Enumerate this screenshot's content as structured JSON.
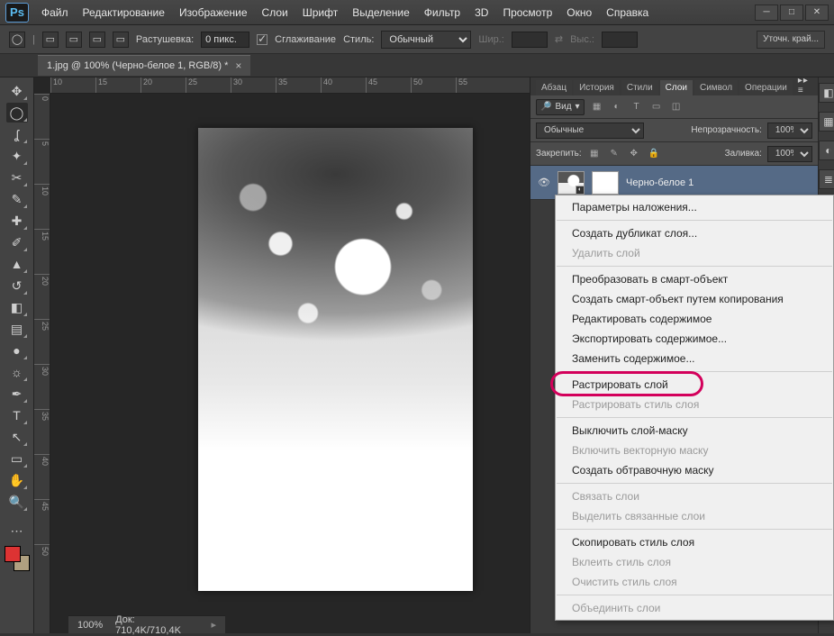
{
  "app_logo": "Ps",
  "menu": [
    "Файл",
    "Редактирование",
    "Изображение",
    "Слои",
    "Шрифт",
    "Выделение",
    "Фильтр",
    "3D",
    "Просмотр",
    "Окно",
    "Справка"
  ],
  "window_controls": {
    "min": "─",
    "max": "□",
    "close": "✕"
  },
  "options_bar": {
    "feather_label": "Растушевка:",
    "feather_value": "0 пикс.",
    "antialias_label": "Сглаживание",
    "style_label": "Стиль:",
    "style_value": "Обычный",
    "width_label": "Шир.:",
    "height_label": "Выс.:",
    "refine_label": "Уточн. край..."
  },
  "document_tab": {
    "title": "1.jpg @ 100% (Черно-белое 1, RGB/8) *"
  },
  "ruler_h": [
    "10",
    "15",
    "20",
    "25",
    "30",
    "35",
    "40",
    "45",
    "50",
    "55"
  ],
  "ruler_v": [
    "0",
    "5",
    "10",
    "15",
    "20",
    "25",
    "30",
    "35",
    "40",
    "45",
    "50"
  ],
  "panel_tabs": [
    "Абзац",
    "История",
    "Стили",
    "Слои",
    "Символ",
    "Операции"
  ],
  "panel_tabs_active_index": 3,
  "layers_panel": {
    "search_label": "Вид",
    "blend_mode": "Обычные",
    "opacity_label": "Непрозрачность:",
    "opacity_value": "100%",
    "lock_label": "Закрепить:",
    "fill_label": "Заливка:",
    "fill_value": "100%",
    "layer_name": "Черно-белое 1"
  },
  "context_menu": {
    "items": [
      {
        "label": "Параметры наложения...",
        "enabled": true
      },
      {
        "sep": true
      },
      {
        "label": "Создать дубликат слоя...",
        "enabled": true
      },
      {
        "label": "Удалить слой",
        "enabled": false
      },
      {
        "sep": true
      },
      {
        "label": "Преобразовать в смарт-объект",
        "enabled": true
      },
      {
        "label": "Создать смарт-объект путем копирования",
        "enabled": true
      },
      {
        "label": "Редактировать содержимое",
        "enabled": true
      },
      {
        "label": "Экспортировать содержимое...",
        "enabled": true
      },
      {
        "label": "Заменить содержимое...",
        "enabled": true
      },
      {
        "sep": true
      },
      {
        "label": "Растрировать слой",
        "enabled": true,
        "highlighted": true
      },
      {
        "label": "Растрировать стиль слоя",
        "enabled": false
      },
      {
        "sep": true
      },
      {
        "label": "Выключить слой-маску",
        "enabled": true
      },
      {
        "label": "Включить векторную маску",
        "enabled": false
      },
      {
        "label": "Создать обтравочную маску",
        "enabled": true
      },
      {
        "sep": true
      },
      {
        "label": "Связать слои",
        "enabled": false
      },
      {
        "label": "Выделить связанные слои",
        "enabled": false
      },
      {
        "sep": true
      },
      {
        "label": "Скопировать стиль слоя",
        "enabled": true
      },
      {
        "label": "Вклеить стиль слоя",
        "enabled": false
      },
      {
        "label": "Очистить стиль слоя",
        "enabled": false
      },
      {
        "sep": true
      },
      {
        "label": "Объединить слои",
        "enabled": false
      }
    ]
  },
  "statusbar": {
    "zoom": "100%",
    "doc_label": "Док: 710,4K/710,4K"
  }
}
